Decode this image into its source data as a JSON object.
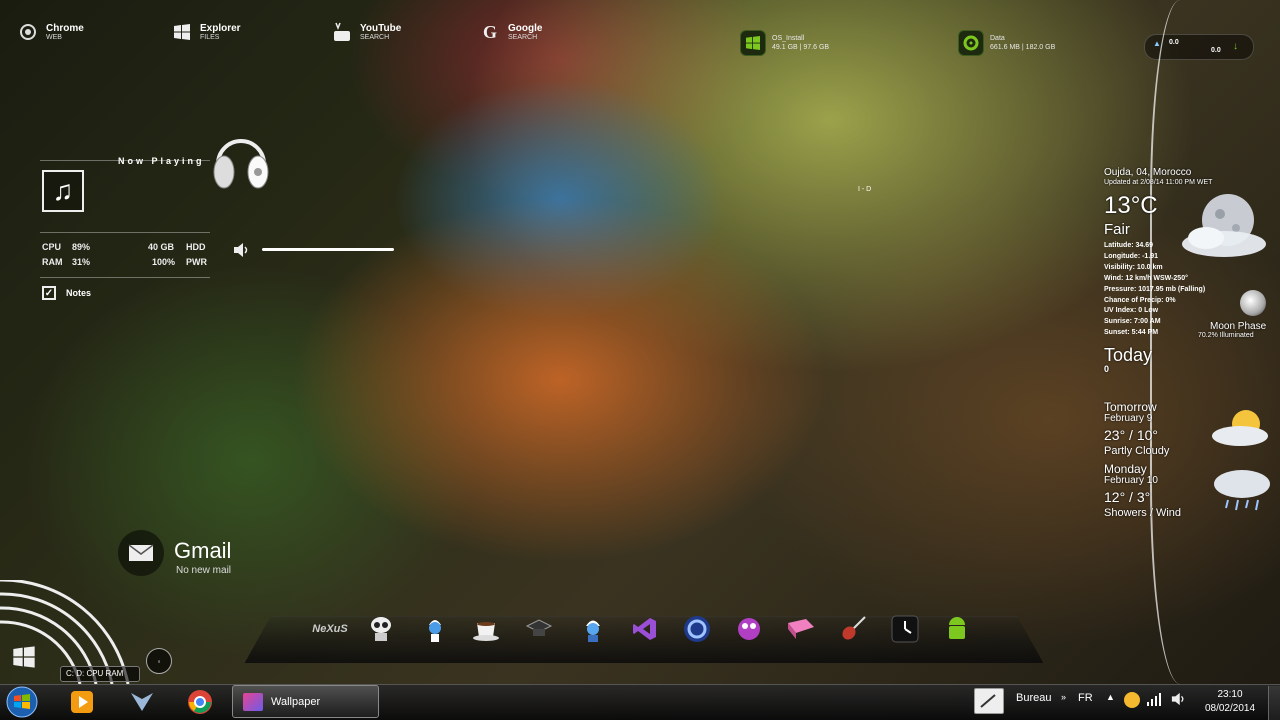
{
  "shortcuts": [
    {
      "title": "Chrome",
      "sub": "WEB",
      "icon": "chrome-icon"
    },
    {
      "title": "Explorer",
      "sub": "FILES",
      "icon": "windows-icon"
    },
    {
      "title": "YouTube",
      "sub": "SEARCH",
      "icon": "youtube-icon"
    },
    {
      "title": "Google",
      "sub": "SEARCH",
      "icon": "google-icon"
    }
  ],
  "drives": [
    {
      "line1": "OS_Install",
      "line2": "49.1 GB | 97.6 GB"
    },
    {
      "line1": "Data",
      "line2": "661.6 MB | 182.0 GB"
    }
  ],
  "network": {
    "up": "0.0",
    "down": "0.0"
  },
  "now_playing": {
    "label": "Now Playing"
  },
  "system": {
    "cpu_label": "CPU",
    "cpu_value": "89%",
    "ram_label": "RAM",
    "ram_value": "31%",
    "hdd_value": "40 GB",
    "hdd_label": "HDD",
    "pwr_value": "100%",
    "pwr_label": "PWR"
  },
  "notes": {
    "label": "Notes"
  },
  "gmail": {
    "title": "Gmail",
    "status": "No new mail"
  },
  "drive_letters": {
    "label": "C:  D:  CPU  RAM"
  },
  "center_label": "I - D",
  "weather": {
    "location": "Oujda, 04, Morocco",
    "updated": "Updated at 2/08/14 11:00 PM WET",
    "temp": "13°C",
    "condition": "Fair",
    "details": [
      "Latitude: 34.69",
      "Longitude: -1.91",
      "Visibility: 10.0 km",
      "Wind: 12 km/h WSW-250°",
      "Pressure: 1017.95 mb (Falling)",
      "Chance of Precip: 0%",
      "UV Index: 0 Low",
      "Sunrise: 7:00 AM",
      "Sunset: 5:44 PM"
    ],
    "moon_phase": "Moon Phase",
    "moon_illum": "70.2% Illuminated",
    "today_label": "Today",
    "today_value": "0",
    "forecast": [
      {
        "day": "Tomorrow",
        "date": "February 9",
        "temps": "23° / 10°",
        "cond": "Partly Cloudy"
      },
      {
        "day": "Monday",
        "date": "February 10",
        "temps": "12° / 3°",
        "cond": "Showers / Wind"
      }
    ]
  },
  "dock_items": [
    "nexus-logo",
    "walle-icon",
    "smurf-icon",
    "coffee-cup-icon",
    "graduation-icon",
    "smurf-gnome-icon",
    "visual-studio-icon",
    "cinema4d-icon",
    "purple-monster-icon",
    "pink-book-icon",
    "guitar-icon",
    "clock-icon",
    "android-icon"
  ],
  "dock_logo_text": "NeXuS",
  "taskbar": {
    "window_title": "Wallpaper",
    "bureau": "Bureau",
    "lang": "FR",
    "time": "23:10",
    "date": "08/02/2014"
  },
  "colors": {
    "accent_green": "#7cc81e",
    "weather_text": "#ffffff"
  }
}
